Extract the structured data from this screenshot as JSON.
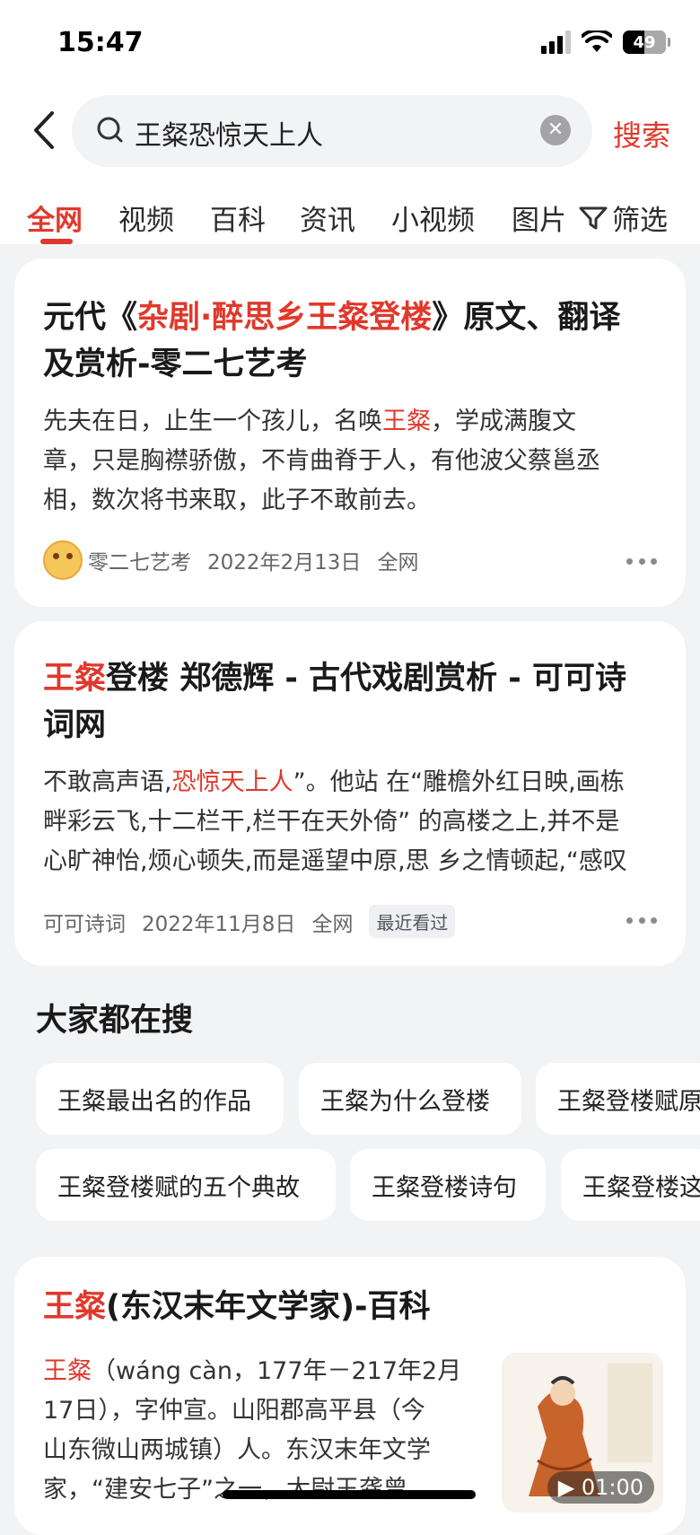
{
  "status": {
    "time": "15:47",
    "battery": "49"
  },
  "search": {
    "query": "王粲恐惊天上人",
    "submit": "搜索"
  },
  "tabs": [
    "全网",
    "视频",
    "百科",
    "资讯",
    "小视频",
    "图片"
  ],
  "filter_label": "筛选",
  "results": [
    {
      "title_pre": "元代《",
      "title_hl": "杂剧·醉思乡王粲登楼",
      "title_post": "》原文、翻译",
      "title_line2": "及赏析-零二七艺考",
      "body_pre": "先夫在日，止生一个孩儿，名唤",
      "body_hl": "王粲",
      "body_post": "，学成满腹文",
      "body_line2": "章，只是胸襟骄傲，不肯曲脊于人，有他波父蔡邕丞",
      "body_line3": "相，数次将书来取，此子不敢前去。",
      "source": "零二七艺考",
      "date": "2022年2月13日",
      "scope": "全网"
    },
    {
      "title_hl": "王粲",
      "title_post": "登楼 郑德辉 - 古代戏剧赏析 - 可可诗",
      "title_line2": "词网",
      "body_pre": "不敢高声语,",
      "body_hl": "恐惊天上人",
      "body_post": "”。他站 在“雕檐外红日映,画栋",
      "body_line2": "畔彩云飞,十二栏干,栏干在天外倚” 的高楼之上,并不是",
      "body_line3": "心旷神怡,烦心顿失,而是遥望中原,思 乡之情顿起,“感叹",
      "source": "可可诗词",
      "date": "2022年11月8日",
      "scope": "全网",
      "badge": "最近看过"
    },
    {
      "title_hl": "王粲",
      "title_post": "(东汉末年文学家)-百科",
      "body_hl": "王粲",
      "body_post": "（wáng càn，177年－217年2月",
      "body_line2": "17日），字仲宣。山阳郡高平县（今",
      "body_line3": "山东微山两城镇）人。东汉末年文学",
      "body_line4": "家，“建安七子”之一，太尉王龚曾",
      "duration": "01:00"
    }
  ],
  "related": {
    "title": "大家都在搜",
    "row1": [
      "王粲最出名的作品",
      "王粲为什么登楼",
      "王粲登楼赋原"
    ],
    "row2": [
      "王粲登楼赋的五个典故",
      "王粲登楼诗句",
      "王粲登楼这"
    ]
  }
}
